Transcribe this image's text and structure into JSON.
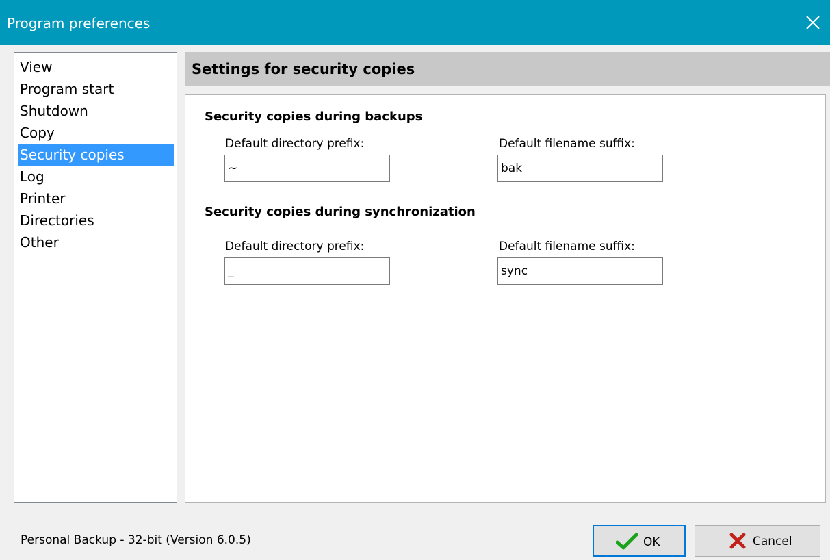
{
  "window": {
    "title": "Program preferences"
  },
  "colors": {
    "titlebar": "#0099bc",
    "selection": "#3399ff",
    "header_bg": "#c8c8c8",
    "ok_check": "#1aa31a",
    "cancel_x": "#c0221a"
  },
  "nav": {
    "items": [
      {
        "label": "View",
        "selected": false
      },
      {
        "label": "Program start",
        "selected": false
      },
      {
        "label": "Shutdown",
        "selected": false
      },
      {
        "label": "Copy",
        "selected": false
      },
      {
        "label": "Security copies",
        "selected": true
      },
      {
        "label": "Log",
        "selected": false
      },
      {
        "label": "Printer",
        "selected": false
      },
      {
        "label": "Directories",
        "selected": false
      },
      {
        "label": "Other",
        "selected": false
      }
    ]
  },
  "panel": {
    "header": "Settings for security copies",
    "backups": {
      "title": "Security copies during backups",
      "prefix_label": "Default directory prefix:",
      "prefix_value": "~",
      "suffix_label": "Default filename suffix:",
      "suffix_value": "bak"
    },
    "sync": {
      "title": "Security copies during synchronization",
      "prefix_label": "Default directory prefix:",
      "prefix_value": "_",
      "suffix_label": "Default filename suffix:",
      "suffix_value": "sync"
    }
  },
  "footer": {
    "status": "Personal Backup - 32-bit (Version 6.0.5)",
    "ok_label": "OK",
    "cancel_label": "Cancel",
    "ok_icon": "checkmark-icon",
    "cancel_icon": "x-icon"
  }
}
